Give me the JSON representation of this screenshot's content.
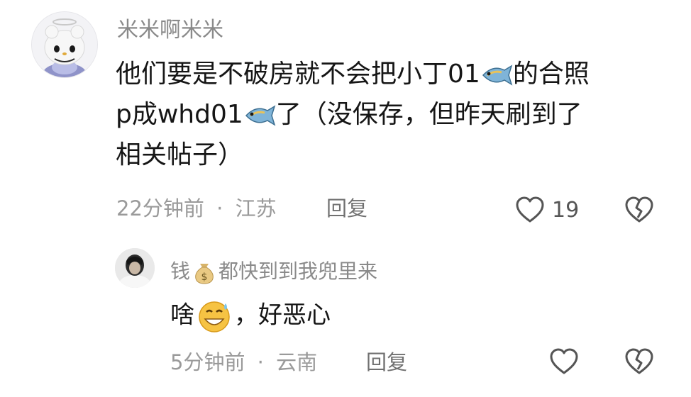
{
  "comment": {
    "username": "米米啊米米",
    "text": {
      "seg1": "他们要是不破房就不会把小丁01",
      "seg2": "的合照",
      "seg3": "p成whd01",
      "seg4": "了（没保存，但昨天刷到了",
      "seg5": "相关帖子）"
    },
    "emoji": "fish-emoji",
    "time": "22分钟前",
    "dot": "·",
    "location": "江苏",
    "reply_label": "回复",
    "like_count": "19"
  },
  "reply": {
    "username_part1": "钱",
    "username_emoji": "money-bag-emoji",
    "username_part2": "都快到到我兜里来",
    "text_part1": "啥",
    "text_emoji": "grinning-sweat-emoji",
    "text_part2": "，好恶心",
    "time": "5分钟前",
    "dot": "·",
    "location": "云南",
    "reply_label": "回复"
  },
  "colors": {
    "meta": "#9a9a9a",
    "text": "#161616",
    "icon": "#555555"
  }
}
